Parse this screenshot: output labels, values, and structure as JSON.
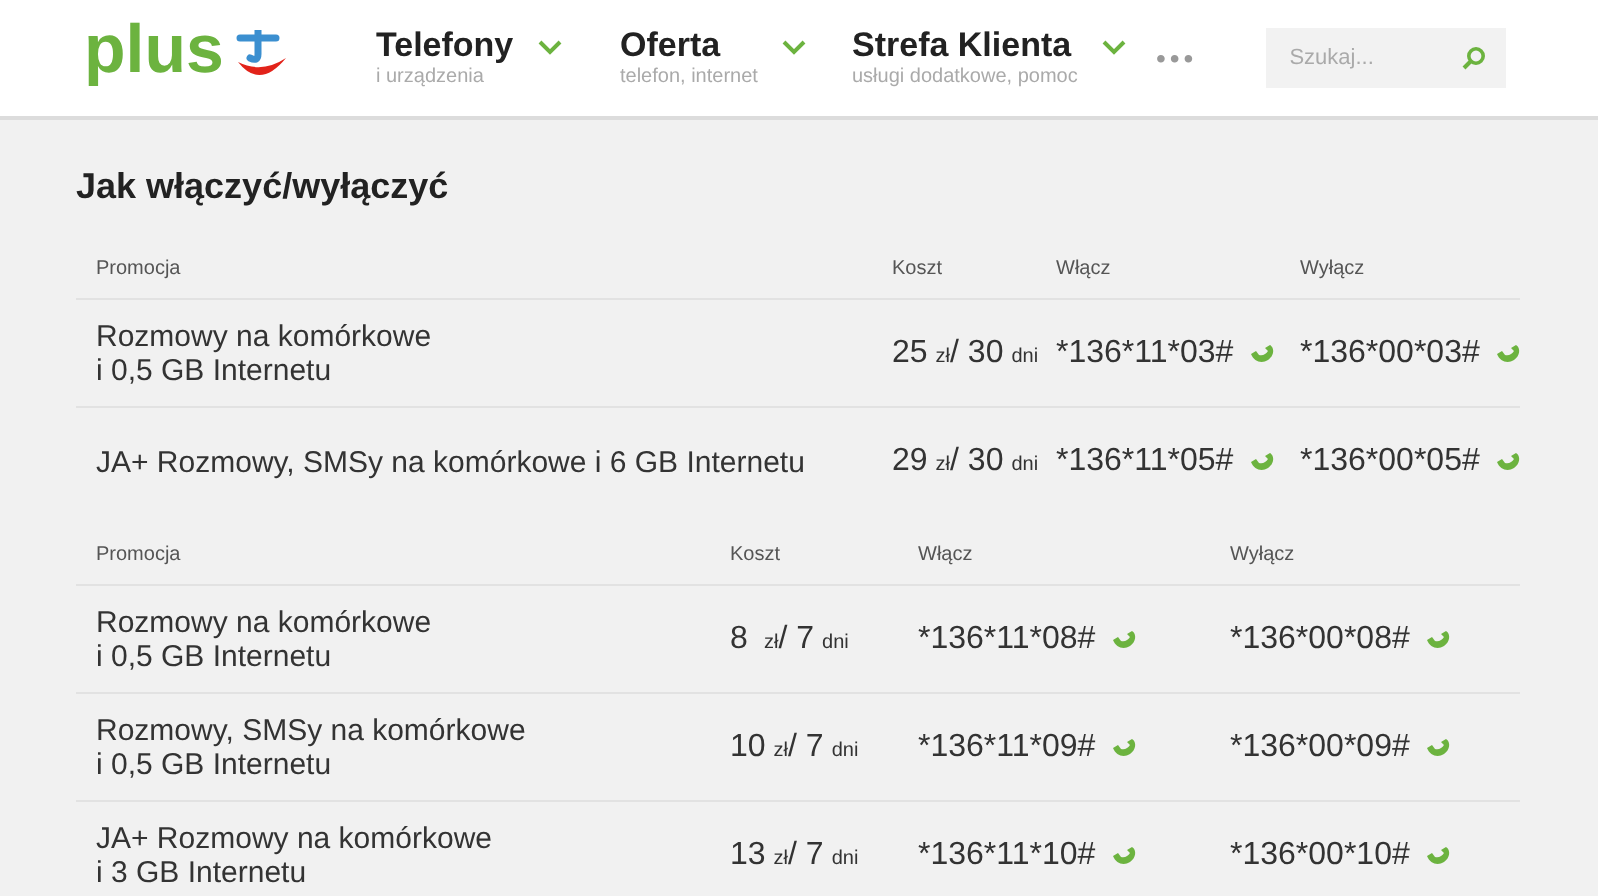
{
  "logo": {
    "text": "plus"
  },
  "nav": [
    {
      "label": "Telefony",
      "sublabel": "i urządzenia"
    },
    {
      "label": "Oferta",
      "sublabel": "telefon, internet"
    },
    {
      "label": "Strefa Klienta",
      "sublabel": "usługi dodatkowe, pomoc"
    }
  ],
  "more": "•••",
  "search": {
    "placeholder": "Szukaj..."
  },
  "heading": "Jak włączyć/wyłączyć",
  "tables": [
    {
      "columns": [
        "Promocja",
        "Koszt",
        "Włącz",
        "Wyłącz"
      ],
      "rows": [
        {
          "promo": [
            "Rozmowy na komórkowe",
            "i 0,5 GB Internetu"
          ],
          "amount": "25",
          "currency": "zł",
          "period": "/ 30",
          "period_unit": "dni",
          "on": "*136*11*03#",
          "off": "*136*00*03#"
        },
        {
          "promo": [
            "JA+ Rozmowy, SMSy na komórkowe i 6 GB Internetu"
          ],
          "amount": "29",
          "currency": "zł",
          "period": "/ 30",
          "period_unit": "dni",
          "on": "*136*11*05#",
          "off": "*136*00*05#"
        }
      ]
    },
    {
      "columns": [
        "Promocja",
        "Koszt",
        "Włącz",
        "Wyłącz"
      ],
      "rows": [
        {
          "promo": [
            "Rozmowy na komórkowe",
            "i 0,5 GB Internetu"
          ],
          "amount": "8",
          "currency": "zł",
          "period": "/ 7",
          "period_unit": "dni",
          "on": "*136*11*08#",
          "off": "*136*00*08#"
        },
        {
          "promo": [
            "Rozmowy, SMSy na komórkowe",
            "i 0,5 GB Internetu"
          ],
          "amount": "10",
          "currency": "zł",
          "period": "/ 7",
          "period_unit": "dni",
          "on": "*136*11*09#",
          "off": "*136*00*09#"
        },
        {
          "promo": [
            "JA+ Rozmowy na komórkowe",
            "i 3 GB Internetu"
          ],
          "amount": "13",
          "currency": "zł",
          "period": "/ 7",
          "period_unit": "dni",
          "on": "*136*11*10#",
          "off": "*136*00*10#"
        }
      ]
    }
  ]
}
